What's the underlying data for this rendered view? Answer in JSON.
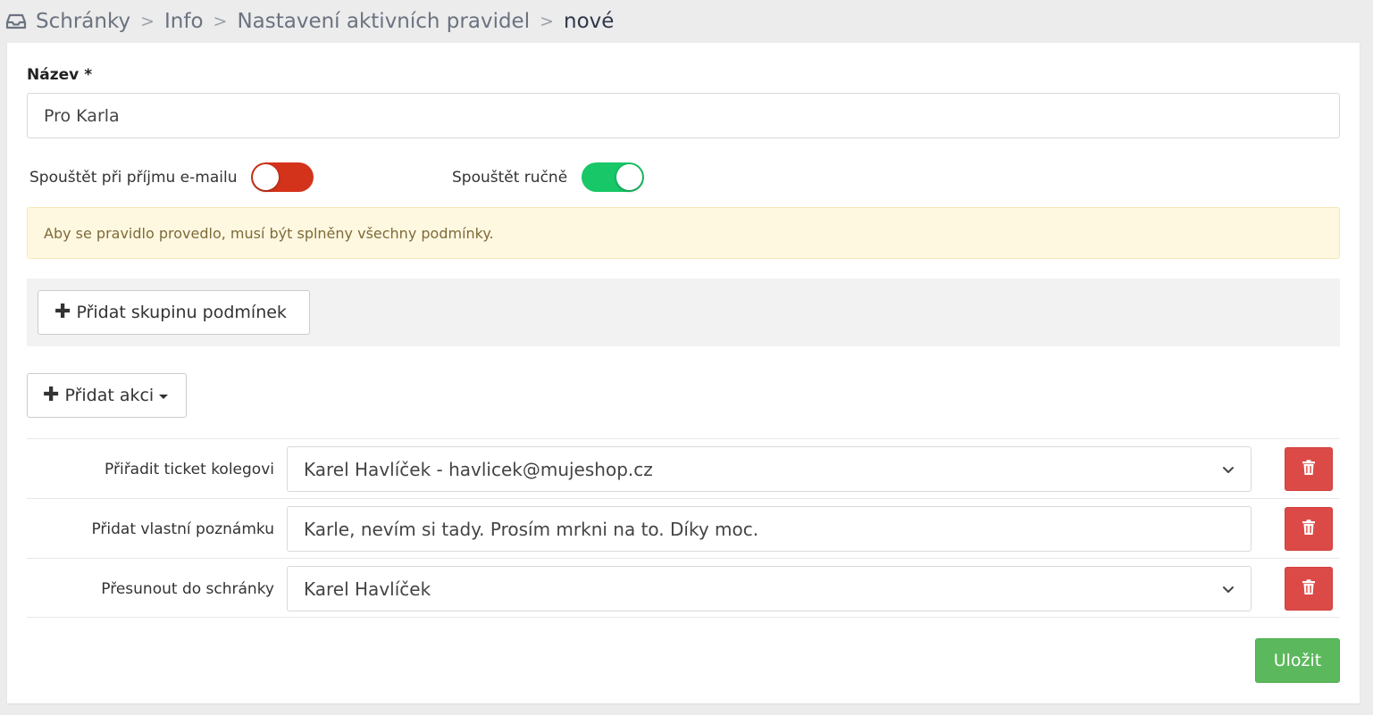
{
  "breadcrumb": {
    "icon": "inbox-icon",
    "items": [
      "Schránky",
      "Info",
      "Nastavení aktivních pravidel"
    ],
    "current": "nové",
    "separator": ">"
  },
  "form": {
    "name_label": "Název",
    "required_mark": "*",
    "name_value": "Pro Karla",
    "toggle_email_label": "Spouštět při příjmu e-mailu",
    "toggle_email_state": "off",
    "toggle_manual_label": "Spouštět ručně",
    "toggle_manual_state": "on",
    "alert_text": "Aby se pravidlo provedlo, musí být splněny všechny podmínky.",
    "add_group_label": "Přidat skupinu podmínek",
    "add_action_label": "Přidat akci",
    "save_label": "Uložit"
  },
  "actions": [
    {
      "label": "Přiřadit ticket kolegovi",
      "value": "Karel Havlíček - havlicek@mujeshop.cz",
      "type": "select"
    },
    {
      "label": "Přidat vlastní poznámku",
      "value": "Karle, nevím si tady. Prosím mrkni na to. Díky moc.",
      "type": "text"
    },
    {
      "label": "Přesunout do schránky",
      "value": "Karel Havlíček",
      "type": "select"
    }
  ],
  "colors": {
    "toggle_off": "#d4331b",
    "toggle_on": "#18c768",
    "alert_bg": "#fff8e1",
    "delete": "#dc4a47",
    "save": "#5cb85c"
  }
}
